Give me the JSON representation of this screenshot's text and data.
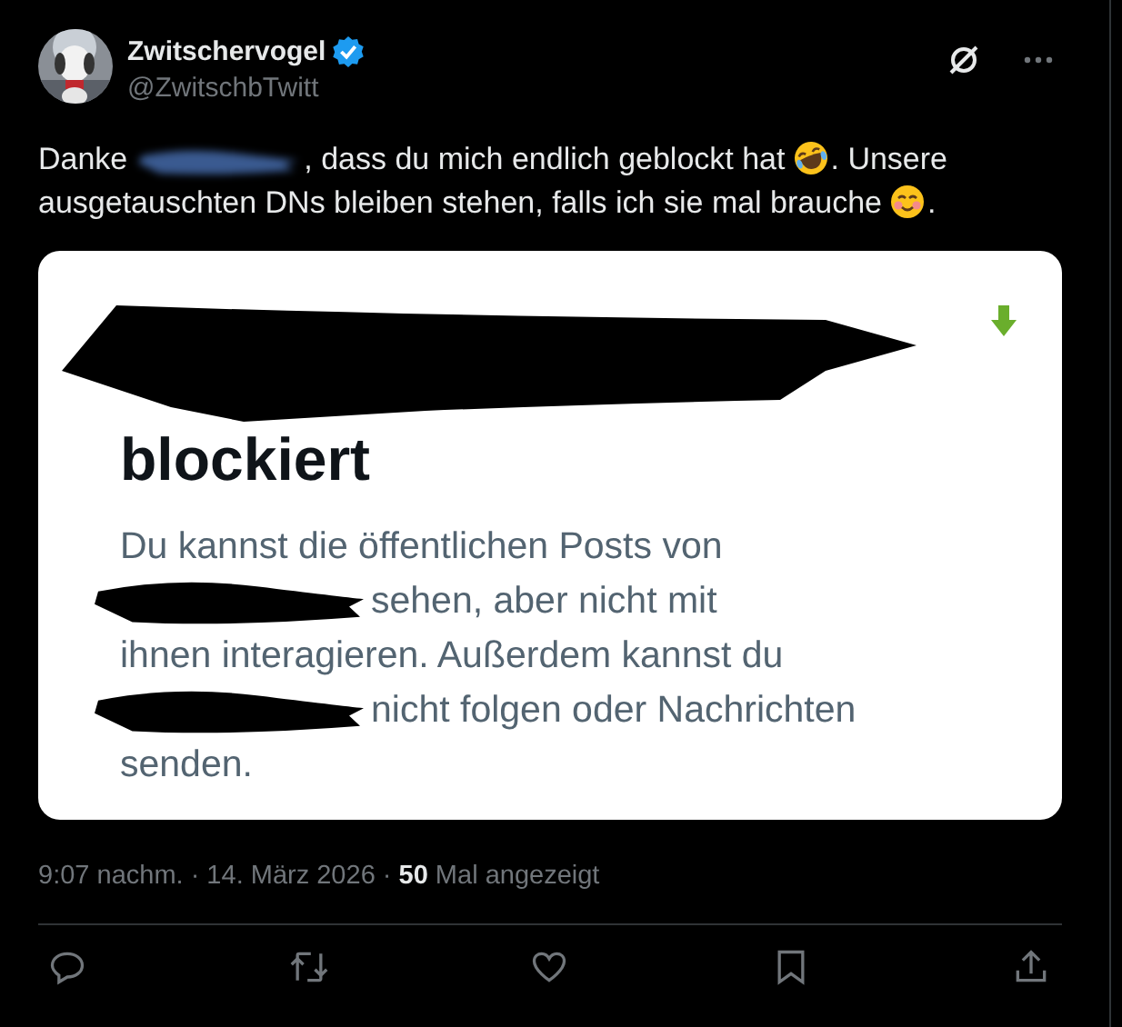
{
  "author": {
    "name": "Zwitschervogel",
    "verified": true,
    "handle": "@ZwitschbTwitt"
  },
  "text": [
    {
      "kind": "text",
      "text": "Danke"
    },
    {
      "kind": "redaction"
    },
    {
      "kind": "text",
      "text": ", dass du mich endlich geblockt hat"
    },
    {
      "kind": "laugh"
    },
    {
      "kind": "text",
      "text": ". Unsere"
    },
    {
      "kind": "text",
      "text": "ausgetauschten DNs bleiben stehen, falls ich sie mal brauche"
    },
    {
      "kind": "smile"
    },
    {
      "kind": "text",
      "text": "."
    }
  ],
  "attachment": {
    "title": "blockiert",
    "lines": [
      [
        {
          "kind": "text",
          "text": "Du kannst die öffentlichen Posts von"
        }
      ],
      [
        {
          "kind": "redaction"
        },
        {
          "kind": "text",
          "text": "sehen, aber nicht mit"
        }
      ],
      [
        {
          "kind": "text",
          "text": "ihnen interagieren. Außerdem kannst du"
        }
      ],
      [
        {
          "kind": "redaction"
        },
        {
          "kind": "text",
          "text": "nicht folgen oder Nachrichten"
        }
      ],
      [
        {
          "kind": "text",
          "text": "senden."
        }
      ]
    ]
  },
  "meta": "9:07 nachm. · 14. März 2026 · **50** Mal angezeigt"
}
